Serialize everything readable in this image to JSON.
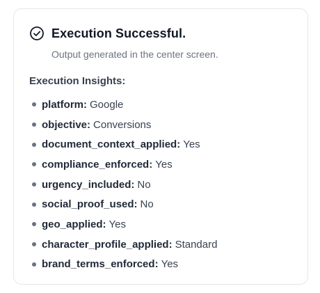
{
  "status": {
    "title": "Execution Successful.",
    "subtitle": "Output generated in the center screen."
  },
  "insights": {
    "title": "Execution Insights:",
    "items": [
      {
        "key": "platform",
        "value": "Google"
      },
      {
        "key": "objective",
        "value": "Conversions"
      },
      {
        "key": "document_context_applied",
        "value": "Yes"
      },
      {
        "key": "compliance_enforced",
        "value": "Yes"
      },
      {
        "key": "urgency_included",
        "value": "No"
      },
      {
        "key": "social_proof_used",
        "value": "No"
      },
      {
        "key": "geo_applied",
        "value": "Yes"
      },
      {
        "key": "character_profile_applied",
        "value": "Standard"
      },
      {
        "key": "brand_terms_enforced",
        "value": "Yes"
      }
    ]
  },
  "icons": {
    "status_icon": "check-circle-icon",
    "bullet_icon": "bullet-dot-icon"
  },
  "colors": {
    "title": "#111827",
    "subtitle": "#6b7280",
    "text": "#374151",
    "border": "#e5e7eb"
  }
}
